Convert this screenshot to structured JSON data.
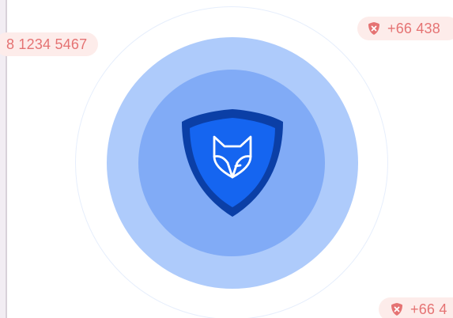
{
  "screen": {
    "center_graphic": {
      "icon": "fox-shield-icon",
      "colors": {
        "outer_ring_stroke": "#e6eefc",
        "middle_disc": "#aecbfb",
        "inner_disc": "#81abf6",
        "shield_border": "#0b3fa6",
        "shield_fill": "#1565f0",
        "fox_stroke": "#ffffff"
      }
    },
    "floating_numbers": [
      {
        "text": "8 1234 5467",
        "icon": null
      },
      {
        "text": "+66 438",
        "icon": "blocked-shield-icon"
      },
      {
        "text": "+66 4",
        "icon": "blocked-shield-icon"
      }
    ],
    "pill_colors": {
      "background": "#fdecea",
      "text": "#e57373"
    }
  }
}
